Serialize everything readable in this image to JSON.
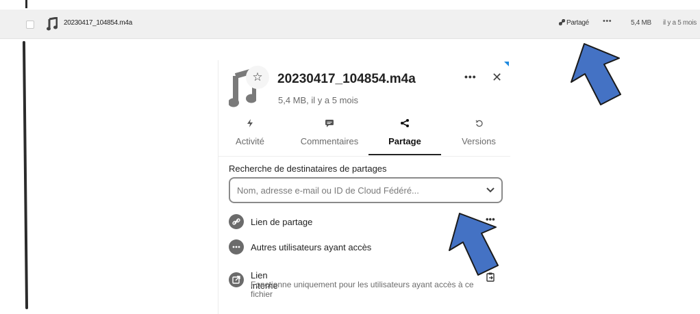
{
  "file_row": {
    "name": "20230417_104854.m4a",
    "share_label": "Partagé",
    "more_label": "•••",
    "size": "5,4 MB",
    "modified": "il y a 5 mois"
  },
  "sidebar": {
    "title": "20230417_104854.m4a",
    "subtitle": "5,4 MB, il y a 5 mois",
    "more_label": "•••",
    "close_label": "✕",
    "favorite_icon": "☆",
    "tabs": [
      {
        "label": "Activité",
        "icon": "activity-icon",
        "glyph": "⚡"
      },
      {
        "label": "Commentaires",
        "icon": "comment-icon",
        "glyph": "▬"
      },
      {
        "label": "Partage",
        "icon": "share-icon",
        "glyph": "<"
      },
      {
        "label": "Versions",
        "icon": "history-icon",
        "glyph": "↺"
      }
    ],
    "active_tab": "Partage",
    "search": {
      "label": "Recherche de destinataires de partages",
      "placeholder": "Nom, adresse e-mail ou ID de Cloud Fédéré..."
    },
    "share_link": {
      "label": "Lien de partage",
      "more_label": "•••"
    },
    "other_users": {
      "label": "Autres utilisateurs ayant accès"
    },
    "internal_link": {
      "title": "Lien interne",
      "description": "Fonctionne uniquement pour les utilisateurs ayant accès à ce fichier"
    }
  },
  "colors": {
    "row_background": "#f0f0f0",
    "arrow_fill": "#4472c4",
    "arrow_stroke": "#1a1a1a",
    "icon_grey": "#6b6b6b",
    "accent": "#1f8ae0"
  }
}
